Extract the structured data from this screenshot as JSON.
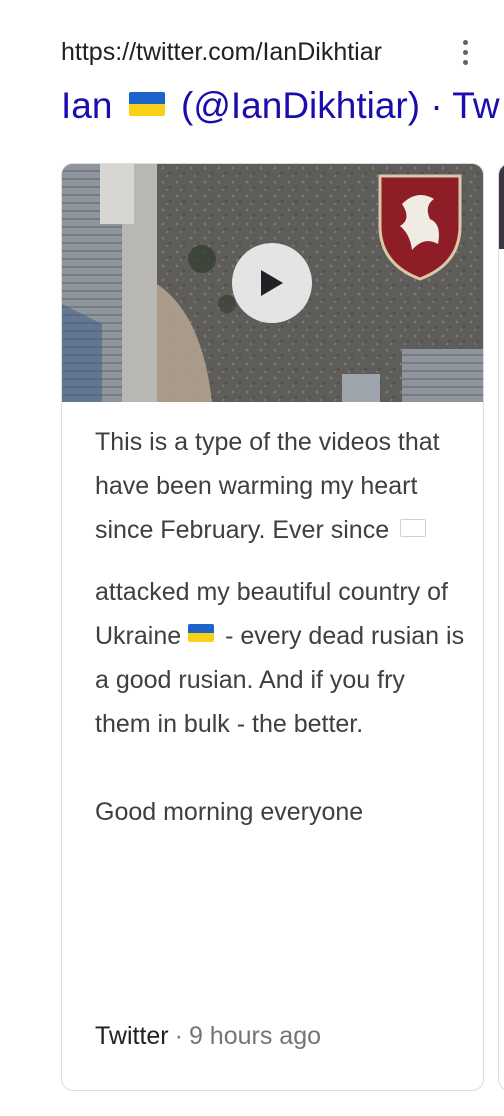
{
  "result": {
    "url": "https://twitter.com/IanDikhtiar",
    "title_prefix": "Ian",
    "title_main": "(@IanDikhtiar) · Tw",
    "title_flag_icon": "ukraine-flag-icon"
  },
  "card": {
    "thumbnail_icon": "video-thumbnail",
    "play_icon": "play-icon",
    "text": {
      "p1_part1": "This is a type of the videos that have been warming my heart since February. Ever since",
      "p1_part2": "attacked my beautiful country of Ukraine",
      "p1_part3": "- every dead rusian is a good rusian. And if you fry them in bulk - the better.",
      "p2": "Good morning everyone"
    },
    "footer": {
      "source": "Twitter",
      "separator": "·",
      "time": "9 hours ago"
    }
  },
  "colors": {
    "link": "#1a0dab",
    "text": "#3c4043",
    "muted": "#70757a",
    "border": "#dadce0"
  }
}
